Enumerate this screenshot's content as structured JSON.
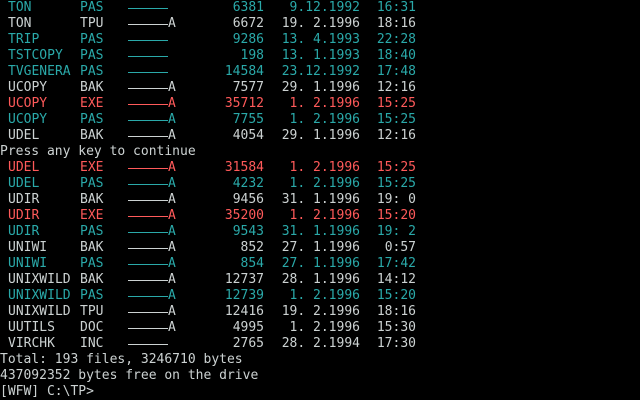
{
  "colors": {
    "white": "#ccd2d2",
    "cyan": "#2aa9a9",
    "red": "#ff5a5a",
    "bg": "#000000"
  },
  "rows_top": [
    {
      "name": "TON",
      "ext": "PAS",
      "attr": "",
      "size": "6381",
      "date": "9.12.1992",
      "time": "16:31",
      "color": "cyan"
    },
    {
      "name": "TON",
      "ext": "TPU",
      "attr": "A",
      "size": "6672",
      "date": "19. 2.1996",
      "time": "18:16",
      "color": "white"
    },
    {
      "name": "TRIP",
      "ext": "PAS",
      "attr": "",
      "size": "9286",
      "date": "13. 4.1993",
      "time": "22:28",
      "color": "cyan"
    },
    {
      "name": "TSTCOPY",
      "ext": "PAS",
      "attr": "",
      "size": "198",
      "date": "13. 1.1993",
      "time": "18:40",
      "color": "cyan"
    },
    {
      "name": "TVGENERA",
      "ext": "PAS",
      "attr": "",
      "size": "14584",
      "date": "23.12.1992",
      "time": "17:48",
      "color": "cyan"
    },
    {
      "name": "UCOPY",
      "ext": "BAK",
      "attr": "A",
      "size": "7577",
      "date": "29. 1.1996",
      "time": "12:16",
      "color": "white"
    },
    {
      "name": "UCOPY",
      "ext": "EXE",
      "attr": "A",
      "size": "35712",
      "date": "1. 2.1996",
      "time": "15:25",
      "color": "red"
    },
    {
      "name": "UCOPY",
      "ext": "PAS",
      "attr": "A",
      "size": "7755",
      "date": "1. 2.1996",
      "time": "15:25",
      "color": "cyan"
    },
    {
      "name": "UDEL",
      "ext": "BAK",
      "attr": "A",
      "size": "4054",
      "date": "29. 1.1996",
      "time": "12:16",
      "color": "white"
    }
  ],
  "pause_text": "Press any key to continue",
  "rows_bottom": [
    {
      "name": "UDEL",
      "ext": "EXE",
      "attr": "A",
      "size": "31584",
      "date": "1. 2.1996",
      "time": "15:25",
      "color": "red"
    },
    {
      "name": "UDEL",
      "ext": "PAS",
      "attr": "A",
      "size": "4232",
      "date": "1. 2.1996",
      "time": "15:25",
      "color": "cyan"
    },
    {
      "name": "UDIR",
      "ext": "BAK",
      "attr": "A",
      "size": "9456",
      "date": "31. 1.1996",
      "time": "19: 0",
      "color": "white"
    },
    {
      "name": "UDIR",
      "ext": "EXE",
      "attr": "A",
      "size": "35200",
      "date": "1. 2.1996",
      "time": "15:20",
      "color": "red"
    },
    {
      "name": "UDIR",
      "ext": "PAS",
      "attr": "A",
      "size": "9543",
      "date": "31. 1.1996",
      "time": "19: 2",
      "color": "cyan"
    },
    {
      "name": "UNIWI",
      "ext": "BAK",
      "attr": "A",
      "size": "852",
      "date": "27. 1.1996",
      "time": "0:57",
      "color": "white"
    },
    {
      "name": "UNIWI",
      "ext": "PAS",
      "attr": "A",
      "size": "854",
      "date": "27. 1.1996",
      "time": "17:42",
      "color": "cyan"
    },
    {
      "name": "UNIXWILD",
      "ext": "BAK",
      "attr": "A",
      "size": "12737",
      "date": "28. 1.1996",
      "time": "14:12",
      "color": "white"
    },
    {
      "name": "UNIXWILD",
      "ext": "PAS",
      "attr": "A",
      "size": "12739",
      "date": "1. 2.1996",
      "time": "15:20",
      "color": "cyan"
    },
    {
      "name": "UNIXWILD",
      "ext": "TPU",
      "attr": "A",
      "size": "12416",
      "date": "19. 2.1996",
      "time": "18:16",
      "color": "white"
    },
    {
      "name": "UUTILS",
      "ext": "DOC",
      "attr": "A",
      "size": "4995",
      "date": "1. 2.1996",
      "time": "15:30",
      "color": "white"
    },
    {
      "name": "VIRCHK",
      "ext": "INC",
      "attr": "",
      "size": "2765",
      "date": "28. 2.1994",
      "time": "17:30",
      "color": "white"
    }
  ],
  "summary": "Total: 193 files, 3246710 bytes",
  "free_space": "437092352 bytes free on the drive",
  "prompt": "[WFW] C:\\TP>"
}
